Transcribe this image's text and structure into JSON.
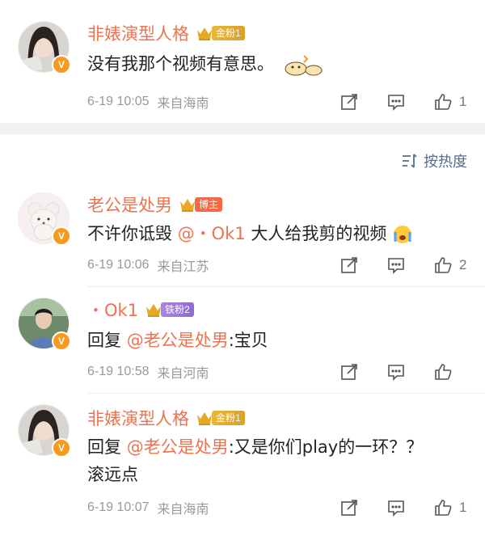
{
  "top_comment": {
    "username": "非婊演型人格",
    "badge": "金粉1",
    "text": "没有我那个视频有意思。",
    "time": "6-19 10:05",
    "location": "来自海南",
    "likes": "1"
  },
  "sort": {
    "label": "按热度"
  },
  "comments": [
    {
      "username": "老公是处男",
      "badge": "博主",
      "text_before": "不许你诋毁",
      "mention": "@・Ok1",
      "text_after": " 大人给我剪的视频",
      "time": "6-19 10:06",
      "location": "来自江苏",
      "likes": "2"
    },
    {
      "username": "・Ok1",
      "badge": "铁粉2",
      "reply_prefix": "回复",
      "mention": "@老公是处男",
      "text_after": ":宝贝",
      "time": "6-19 10:58",
      "location": "来自河南",
      "likes": ""
    },
    {
      "username": "非婊演型人格",
      "badge": "金粉1",
      "reply_prefix": "回复",
      "mention": "@老公是处男",
      "text_after": ":又是你们play的一环？？",
      "text_line2": "滚远点",
      "time": "6-19 10:07",
      "location": "来自海南",
      "likes": "1"
    }
  ],
  "colors": {
    "username": "#eb7350",
    "meta": "#999999",
    "sort": "#5a6b8c",
    "separator": "#f2f2f2"
  },
  "icons": [
    "crown-icon",
    "v-badge-icon",
    "share-icon",
    "comment-icon",
    "like-icon",
    "sort-icon"
  ]
}
